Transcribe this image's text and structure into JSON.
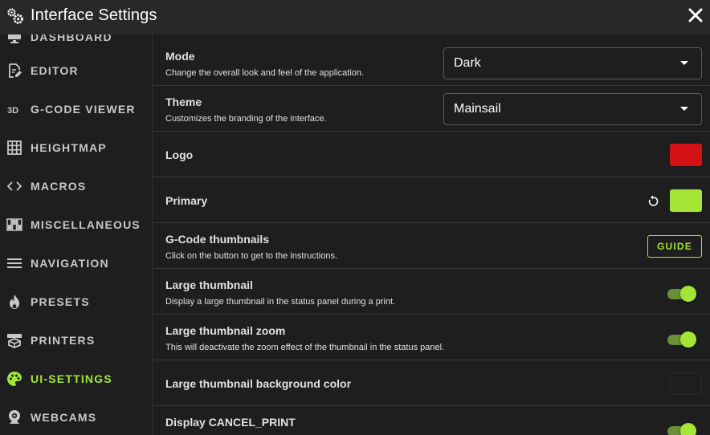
{
  "window": {
    "title": "Interface Settings"
  },
  "sidebar": {
    "items": [
      {
        "label": "Dashboard",
        "icon": "monitor-icon",
        "active": false
      },
      {
        "label": "Editor",
        "icon": "file-edit-icon",
        "active": false
      },
      {
        "label": "G-Code Viewer",
        "icon": "3d-icon",
        "active": false
      },
      {
        "label": "Heightmap",
        "icon": "grid-icon",
        "active": false
      },
      {
        "label": "Macros",
        "icon": "code-icon",
        "active": false
      },
      {
        "label": "Miscellaneous",
        "icon": "dip-switch-icon",
        "active": false
      },
      {
        "label": "Navigation",
        "icon": "menu-icon",
        "active": false
      },
      {
        "label": "Presets",
        "icon": "fire-icon",
        "active": false
      },
      {
        "label": "Printers",
        "icon": "printer-3d-icon",
        "active": false
      },
      {
        "label": "UI-Settings",
        "icon": "palette-icon",
        "active": true
      },
      {
        "label": "Webcams",
        "icon": "webcam-icon",
        "active": false
      }
    ]
  },
  "settings": {
    "mode": {
      "title": "Mode",
      "description": "Change the overall look and feel of the application.",
      "value": "Dark"
    },
    "theme": {
      "title": "Theme",
      "description": "Customizes the branding of the interface.",
      "value": "Mainsail"
    },
    "logo": {
      "title": "Logo",
      "color": "#d41216"
    },
    "primary": {
      "title": "Primary",
      "color": "#a3e635"
    },
    "gcode_thumbnails": {
      "title": "G-Code thumbnails",
      "description": "Click on the button to get to the instructions.",
      "button_label": "GUIDE"
    },
    "large_thumbnail": {
      "title": "Large thumbnail",
      "description": "Display a large thumbnail in the status panel during a print.",
      "enabled": true
    },
    "large_thumbnail_zoom": {
      "title": "Large thumbnail zoom",
      "description": "This will deactivate the zoom effect of the thumbnail in the status panel.",
      "enabled": true
    },
    "large_thumbnail_bg": {
      "title": "Large thumbnail background color",
      "color": "#1e1e1e"
    },
    "display_cancel_print": {
      "title": "Display CANCEL_PRINT",
      "enabled": true
    }
  },
  "colors": {
    "accent": "#a3e635",
    "background": "#1e1e1e",
    "titlebar": "#282828"
  }
}
